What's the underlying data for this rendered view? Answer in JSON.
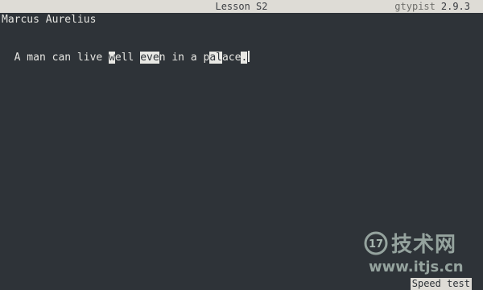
{
  "titlebar": {
    "lesson": "Lesson S2",
    "app_name": "gtypist",
    "version": "2.9.3"
  },
  "drill": {
    "author": "Marcus Aurelius",
    "segments": [
      {
        "text": "A man can live ",
        "hl": false
      },
      {
        "text": "w",
        "hl": true
      },
      {
        "text": "ell ",
        "hl": false
      },
      {
        "text": "eve",
        "hl": true
      },
      {
        "text": "n in a p",
        "hl": false
      },
      {
        "text": "al",
        "hl": true
      },
      {
        "text": "ace",
        "hl": false
      },
      {
        "text": ".",
        "hl": true
      }
    ]
  },
  "watermark": {
    "logo_text": "17",
    "brand": "技术网",
    "url": "www.itjs.cn"
  },
  "status": {
    "mode": "Speed test"
  }
}
